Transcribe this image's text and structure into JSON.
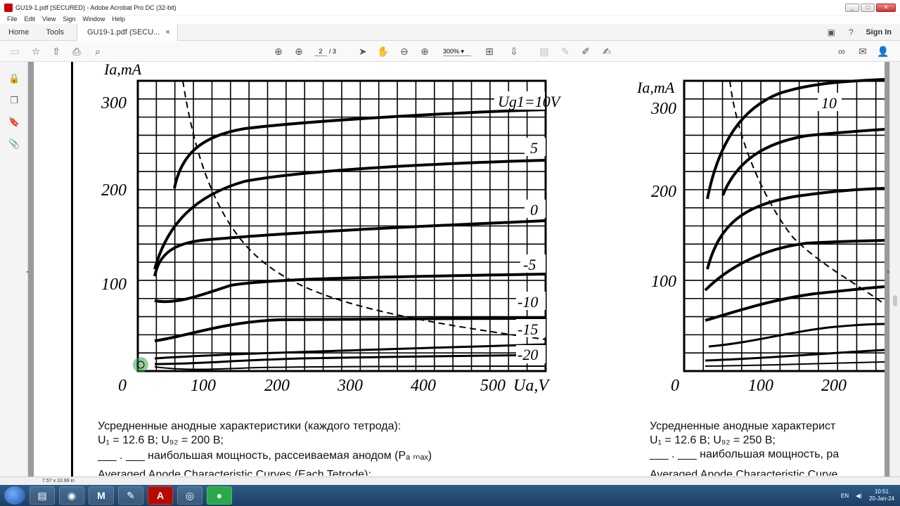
{
  "window": {
    "title": "GU19-1.pdf (SECURED) - Adobe Acrobat Pro DC (32-bit)",
    "min": "_",
    "max": "□",
    "close": "✕"
  },
  "menu": [
    "File",
    "Edit",
    "View",
    "Sign",
    "Window",
    "Help"
  ],
  "tabs": {
    "home": "Home",
    "tools": "Tools",
    "doc": "GU19-1.pdf (SECU...",
    "doc_close": "×",
    "sign_in": "Sign In"
  },
  "toolbar": {
    "page_current": "2",
    "page_total": "/ 3",
    "zoom": "300%"
  },
  "status": {
    "page_size": "7.57 x 10.99 in"
  },
  "taskbar": {
    "lang": "EN",
    "time": "10:51",
    "date": "20-Jan-24"
  },
  "chart_left": {
    "ylabel": "Ia,mA",
    "xlabel": "Ua,V",
    "yticks": [
      "300",
      "200",
      "100"
    ],
    "xticks": [
      "0",
      "100",
      "200",
      "300",
      "400",
      "500"
    ],
    "curve_labels": [
      "Ug1=10V",
      "5",
      "0",
      "-5",
      "-10",
      "-15",
      "-20"
    ]
  },
  "chart_right": {
    "ylabel": "Ia,mA",
    "yticks": [
      "300",
      "200",
      "100"
    ],
    "xticks": [
      "0",
      "100",
      "200"
    ],
    "curve_labels": [
      "10"
    ]
  },
  "caption_left": {
    "line1": "Усредненные анодные характеристики (каждого тетрода):",
    "line2": "U₁ = 12.6 В; U₉₂ = 200 В;",
    "line3": "___ . ___  наибольшая мощность, рассеиваемая анодом (Pₐ ₘₐₓ)",
    "line4": "Averaged Anode Characteristic Curves (Each Tetrode):"
  },
  "caption_right": {
    "line1": "Усредненные анодные характерист",
    "line2": "U₁ = 12.6 В; U₉₂ = 250 В;",
    "line3": "___ . ___  наибольшая мощность, ра",
    "line4": "Averaged Anode Characteristic Curve"
  }
}
